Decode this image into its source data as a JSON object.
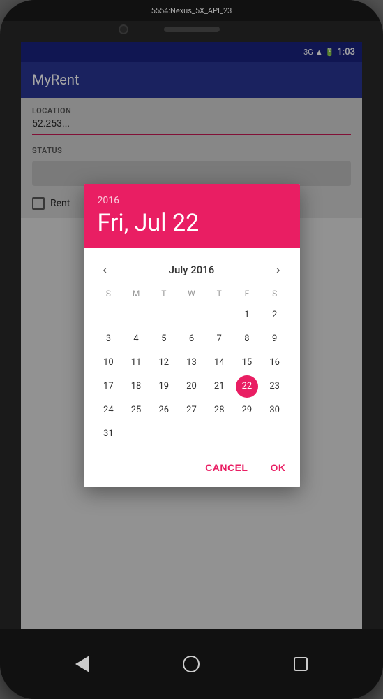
{
  "phone": {
    "emulator_label": "5554:Nexus_5X_API_23"
  },
  "status_bar": {
    "time": "1:03",
    "signal": "3G",
    "battery": "▪"
  },
  "app_bar": {
    "title": "MyRent"
  },
  "main_content": {
    "location_label": "LOCATION",
    "location_value": "52.253...",
    "status_label": "STATUS",
    "rent_checkbox_label": "Rent"
  },
  "dialog": {
    "year": "2016",
    "date": "Fri, Jul 22",
    "month_title": "July 2016",
    "prev_icon": "‹",
    "next_icon": "›",
    "weekdays": [
      "S",
      "M",
      "T",
      "W",
      "T",
      "F",
      "S"
    ],
    "weeks": [
      [
        null,
        null,
        null,
        null,
        null,
        1,
        2
      ],
      [
        3,
        4,
        5,
        6,
        7,
        8,
        9
      ],
      [
        10,
        11,
        12,
        13,
        14,
        15,
        16
      ],
      [
        17,
        18,
        19,
        20,
        21,
        22,
        23
      ],
      [
        24,
        25,
        26,
        27,
        28,
        29,
        30
      ],
      [
        31,
        null,
        null,
        null,
        null,
        null,
        null
      ]
    ],
    "selected_day": 22,
    "cancel_label": "CANCEL",
    "ok_label": "OK"
  },
  "nav": {
    "back": "◁",
    "home": "○",
    "square": "□"
  },
  "colors": {
    "accent": "#e91e63",
    "app_bar": "#283593",
    "status_bar": "#1a237e"
  }
}
